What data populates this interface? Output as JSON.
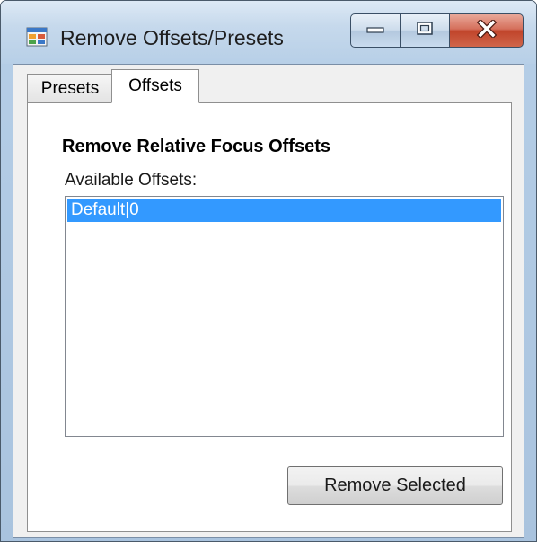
{
  "window": {
    "title": "Remove Offsets/Presets",
    "icon": "application-window-icon",
    "caption_buttons": [
      "minimize-icon",
      "maximize-icon",
      "close-icon"
    ]
  },
  "tabs": [
    {
      "label": "Presets",
      "selected": false
    },
    {
      "label": "Offsets",
      "selected": true
    }
  ],
  "offsets_tab": {
    "heading": "Remove Relative Focus Offsets",
    "list_label": "Available Offsets:",
    "items": [
      {
        "label": "Default|0",
        "selected": true
      }
    ],
    "remove_button_label": "Remove Selected"
  },
  "colors": {
    "selection": "#3399ff",
    "close_button": "#c0442b"
  }
}
